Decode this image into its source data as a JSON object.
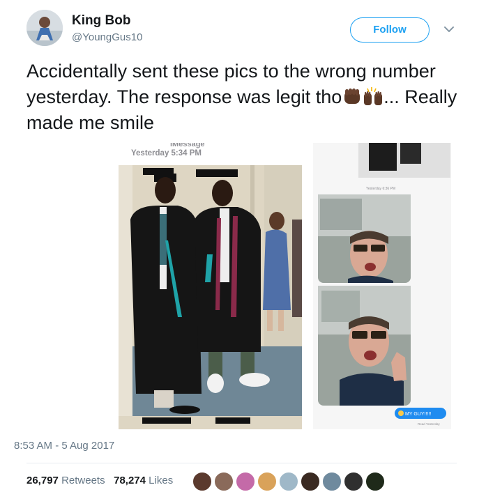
{
  "author": {
    "name": "King Bob",
    "handle": "@YoungGus10"
  },
  "follow_label": "Follow",
  "tweet": {
    "text_before_emoji": "Accidentally sent these pics to the wrong number yesterday. The response was legit tho",
    "text_after_emoji": "... Really made me smile"
  },
  "screenshot": {
    "imessage_label": "iMessage",
    "left_timestamp": "Yesterday 5:34 PM",
    "right_timestamp": "Yesterday 6:36 PM",
    "reply_text": "MY GUY!!!!!",
    "read_receipt": "Read Yesterday"
  },
  "timestamp": "8:53 AM - 5 Aug 2017",
  "stats": {
    "retweets_count": "26,797",
    "retweets_label": "Retweets",
    "likes_count": "78,274",
    "likes_label": "Likes"
  },
  "colors": {
    "accent": "#1da1f2",
    "text": "#14171a",
    "muted": "#657786"
  }
}
